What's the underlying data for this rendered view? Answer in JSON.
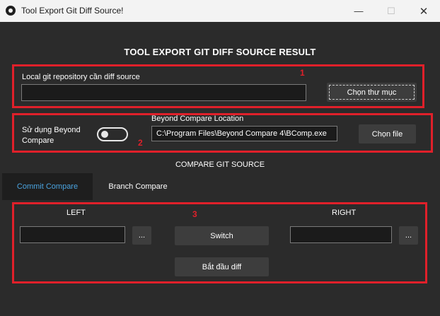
{
  "window": {
    "title": "Tool Export Git Diff Source!",
    "minimize": "—",
    "maximize": "☐",
    "close": "✕"
  },
  "header": {
    "title": "TOOL EXPORT GIT DIFF SOURCE RESULT"
  },
  "repo": {
    "label": "Local git repository cần diff source",
    "value": "",
    "browse_label": "Chọn thư mục"
  },
  "beyond": {
    "toggle_label": "Sử dụng Beyond Compare",
    "toggle_on": false,
    "location_label": "Beyond Compare Location",
    "location_value": "C:\\Program Files\\Beyond Compare 4\\BComp.exe",
    "browse_label": "Chọn file"
  },
  "compare": {
    "section_title": "COMPARE GIT SOURCE",
    "tabs": [
      {
        "label": "Commit Compare",
        "active": true
      },
      {
        "label": "Branch Compare",
        "active": false
      }
    ],
    "left_label": "LEFT",
    "right_label": "RIGHT",
    "left_value": "",
    "right_value": "",
    "ellipsis": "...",
    "switch_label": "Switch",
    "start_label": "Bắt đầu diff"
  },
  "annotations": {
    "box1": "1",
    "box2": "2",
    "box3": "3",
    "color": "#e0202a"
  },
  "colors": {
    "background": "#2b2b2b",
    "accent": "#4aa3df",
    "button": "#3d3d3d",
    "input": "#1b1b1b"
  }
}
